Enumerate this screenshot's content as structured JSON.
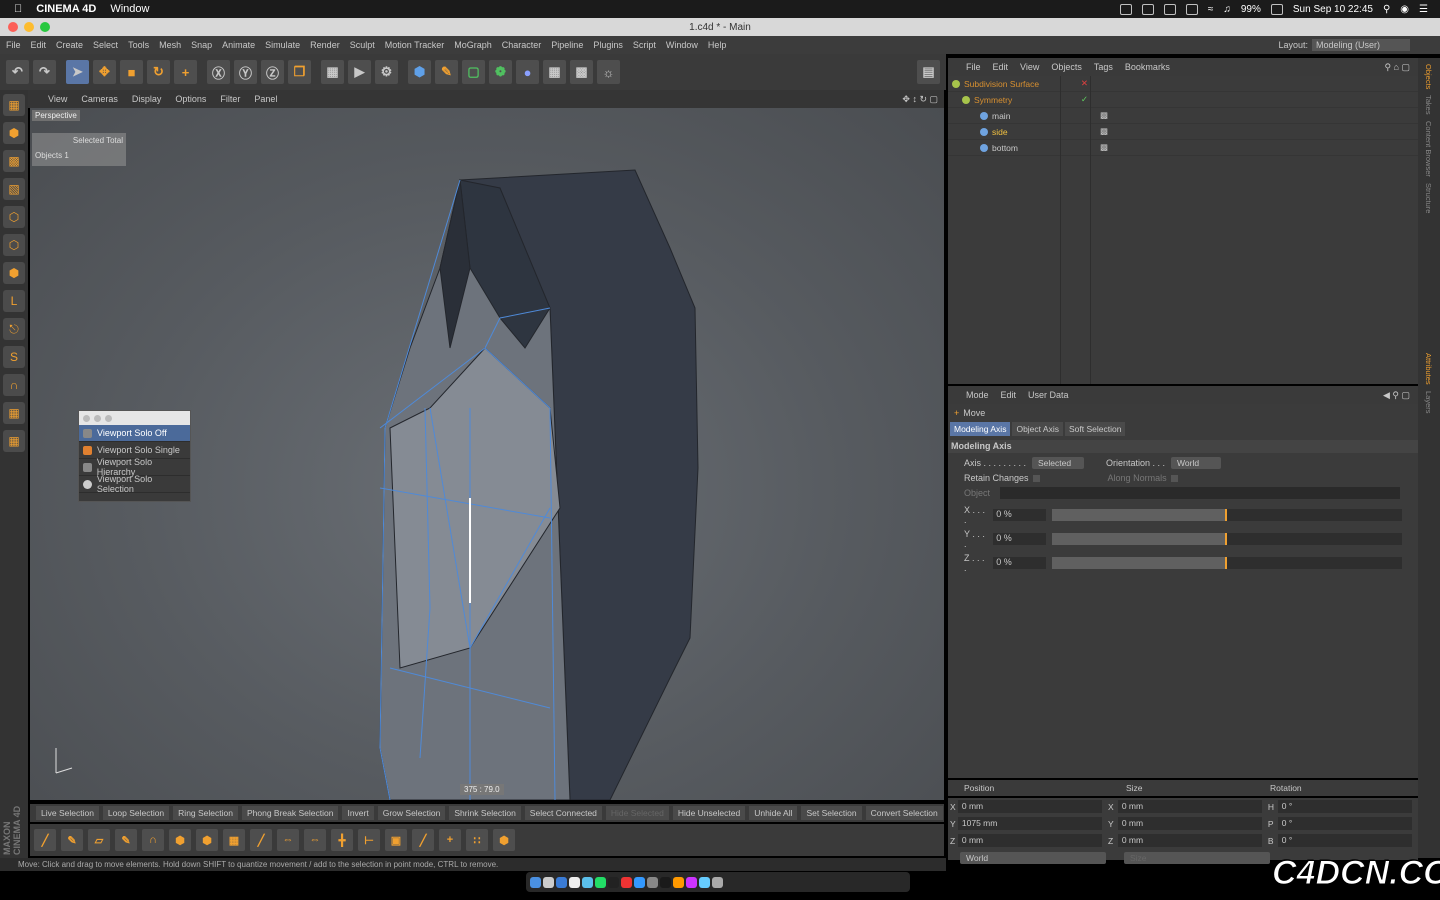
{
  "mac": {
    "app": "CINEMA 4D",
    "menu_window": "Window",
    "battery": "99%",
    "datetime": "Sun Sep 10  22:45"
  },
  "window": {
    "title": "1.c4d * - Main"
  },
  "menus": [
    "File",
    "Edit",
    "Create",
    "Select",
    "Tools",
    "Mesh",
    "Snap",
    "Animate",
    "Simulate",
    "Render",
    "Sculpt",
    "Motion Tracker",
    "MoGraph",
    "Character",
    "Pipeline",
    "Plugins",
    "Script",
    "Window",
    "Help"
  ],
  "layout": {
    "label": "Layout:",
    "value": "Modeling (User)"
  },
  "viewport": {
    "menus": [
      "View",
      "Cameras",
      "Display",
      "Options",
      "Filter",
      "Panel"
    ],
    "camera": "Perspective",
    "hud_header": "Selected  Total",
    "hud_row": "Objects   1",
    "readout": "375 : 79.0"
  },
  "solo_menu": [
    "Viewport Solo Off",
    "Viewport Solo Single",
    "Viewport Solo Hierarchy",
    "Viewport Solo Selection"
  ],
  "selection_bar": [
    "Live Selection",
    "Loop Selection",
    "Ring Selection",
    "Phong Break Selection",
    "Invert",
    "Grow Selection",
    "Shrink Selection",
    "Select Connected",
    "Hide Selected",
    "Hide Unselected",
    "Unhide All",
    "Set Selection",
    "Convert Selection"
  ],
  "status": "Move: Click and drag to move elements. Hold down SHIFT to quantize movement / add to the selection in point mode, CTRL to remove.",
  "objects_menu": [
    "File",
    "Edit",
    "View",
    "Objects",
    "Tags",
    "Bookmarks"
  ],
  "objects": [
    {
      "name": "Subdivision Surface",
      "color": "#a7c44b"
    },
    {
      "name": "Symmetry",
      "color": "#a7c44b"
    },
    {
      "name": "main",
      "color": "#6fa3e0"
    },
    {
      "name": "side",
      "color": "#6fa3e0"
    },
    {
      "name": "bottom",
      "color": "#6fa3e0"
    }
  ],
  "attr_menu": [
    "Mode",
    "Edit",
    "User Data"
  ],
  "attr": {
    "tool": "Move",
    "tabs": [
      "Modeling Axis",
      "Object Axis",
      "Soft Selection"
    ],
    "section": "Modeling Axis",
    "axis_label": "Axis . . . . . . . . .",
    "axis_value": "Selected",
    "orient_label": "Orientation . . .",
    "orient_value": "World",
    "retain": "Retain Changes",
    "normals": "Along Normals",
    "object": "Object",
    "x_label": "X . . . .",
    "x_value": "0 %",
    "y_label": "Y . . . .",
    "y_value": "0 %",
    "z_label": "Z . . . .",
    "z_value": "0 %",
    "slider_fraction": 0.5
  },
  "coords": {
    "headers": [
      "Position",
      "Size",
      "Rotation"
    ],
    "rows": [
      [
        "X",
        "0 mm",
        "X",
        "0 mm",
        "H",
        "0 °"
      ],
      [
        "Y",
        "1075 mm",
        "Y",
        "0 mm",
        "P",
        "0 °"
      ],
      [
        "Z",
        "0 mm",
        "Z",
        "0 mm",
        "B",
        "0 °"
      ]
    ],
    "space": "World",
    "size_mode": "Size"
  },
  "right_tabs": [
    "Objects",
    "Takes",
    "Content Browser",
    "Structure",
    "Attributes",
    "Layers"
  ],
  "watermark": "C4DCN.COM"
}
